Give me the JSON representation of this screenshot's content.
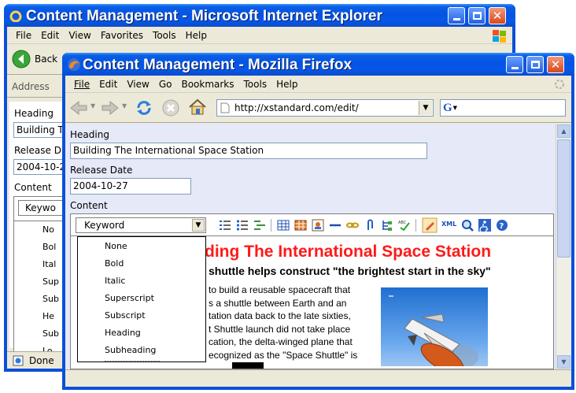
{
  "ie": {
    "title": "Content Management - Microsoft Internet Explorer",
    "menu": [
      "File",
      "Edit",
      "View",
      "Favorites",
      "Tools",
      "Help"
    ],
    "back_label": "Back",
    "address_label": "Address",
    "heading_label": "Heading",
    "heading_value": "Building T",
    "release_label": "Release D",
    "release_value": "2004-10-2",
    "content_label": "Content",
    "keyword_value": "Keywo",
    "list": [
      "No",
      "Bol",
      "Ital",
      "Sup",
      "Sub",
      "He",
      "Sub",
      "Lo"
    ],
    "status": "Done"
  },
  "ff": {
    "title": "Content Management - Mozilla Firefox",
    "menu": [
      "File",
      "Edit",
      "View",
      "Go",
      "Bookmarks",
      "Tools",
      "Help"
    ],
    "url": "http://xstandard.com/edit/",
    "search_value": "G",
    "heading_label": "Heading",
    "heading_value": "Building The International Space Station",
    "release_label": "Release Date",
    "release_value": "2004-10-27",
    "content_label": "Content",
    "keyword_value": "Keyword",
    "toolbar_text": "XML",
    "dropdown": [
      "None",
      "Bold",
      "Italic",
      "Superscript",
      "Subscript",
      "Heading",
      "Subheading"
    ],
    "doc_h1": "ding The International Space Station",
    "doc_h2": "shuttle helps construct \"the brightest start in the sky\"",
    "doc_lines": [
      "to build a reusable spacecraft that",
      "s a shuttle between Earth and an",
      "tation data back to the late sixties,",
      "t Shuttle launch did not take place",
      "cation, the delta-winged plane that",
      "ecognized as the \"Space Shuttle\" is"
    ]
  },
  "colors": {
    "title_blue": "#0554e3",
    "close_red": "#d8471d",
    "heading_red": "#ff1a1a",
    "content_bg": "#e6e9f8"
  }
}
